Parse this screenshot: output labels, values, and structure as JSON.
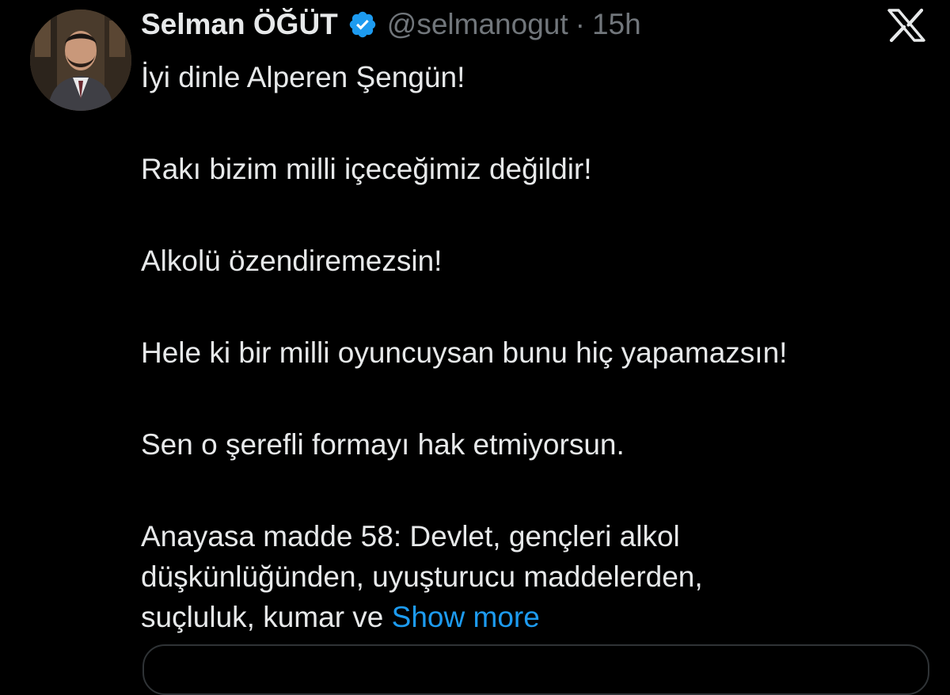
{
  "author": {
    "name": "Selman ÖĞÜT",
    "handle": "@selmanogut",
    "separator": "·",
    "time": "15h",
    "verified_icon": "verified-badge-icon",
    "verified_color": "#1d9bf0"
  },
  "brand": {
    "logo": "x-logo-icon"
  },
  "tweet": {
    "paragraphs": [
      "İyi dinle Alperen Şengün!",
      "Rakı bizim milli içeceğimiz değildir!",
      "Alkolü özendiremezsin!",
      "Hele ki bir milli oyuncuysan bunu hiç yapamazsın!",
      "Sen o şerefli formayı hak etmiyorsun."
    ],
    "last_paragraph": {
      "line1": "Anayasa madde 58: Devlet, gençleri alkol",
      "line2": "düşkünlüğünden, uyuşturucu maddelerden,",
      "line3": "suçluluk, kumar ve"
    },
    "show_more": "Show more",
    "link_color": "#1d9bf0"
  },
  "colors": {
    "background": "#000000",
    "text": "#e7e9ea",
    "muted": "#71767b",
    "border": "#2f3336"
  }
}
